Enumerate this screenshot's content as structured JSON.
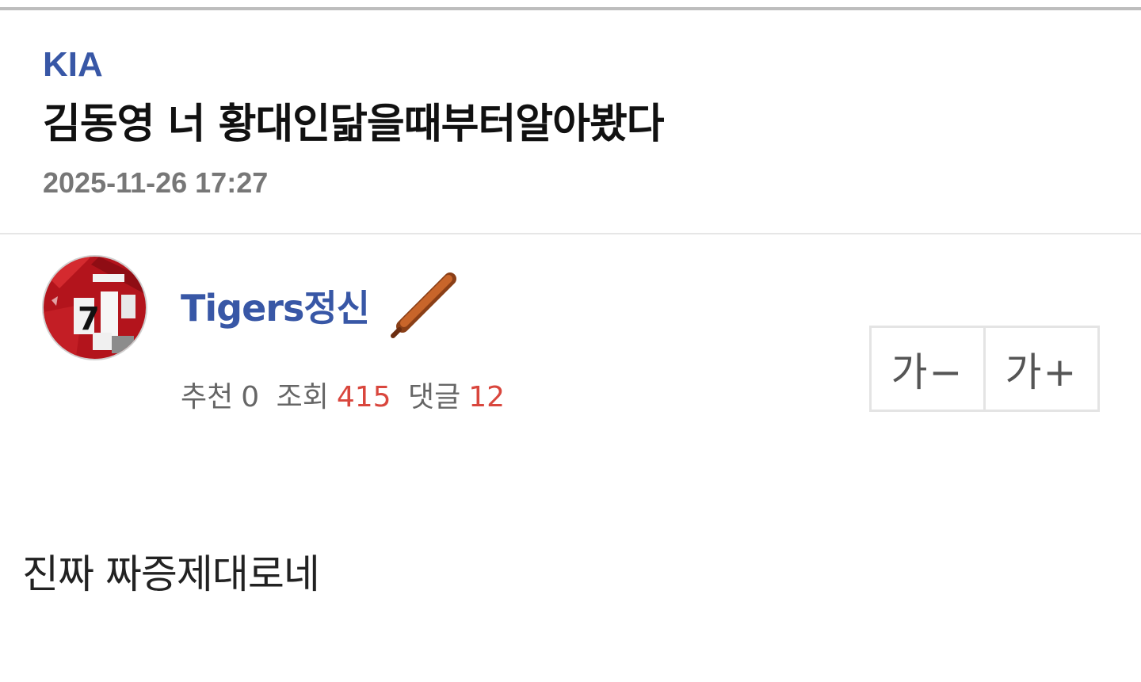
{
  "post": {
    "category": "KIA",
    "title": "김동영 너 황대인닮을때부터알아봤다",
    "datetime": "2025-11-26 17:27",
    "body": "진짜 짜증제대로네"
  },
  "author": {
    "name": "Tigers정신",
    "avatar_icon": "jersey-avatar",
    "badge_icon": "baseball-bat-icon"
  },
  "stats": {
    "recommend_label": "추천",
    "recommend_count": "0",
    "views_label": "조회",
    "views_count": "415",
    "comments_label": "댓글",
    "comments_count": "12"
  },
  "font_controls": {
    "decrease_label": "가−",
    "increase_label": "가+"
  },
  "colors": {
    "accent_blue": "#3857a6",
    "count_red": "#d9463d",
    "meta_gray": "#777777"
  }
}
